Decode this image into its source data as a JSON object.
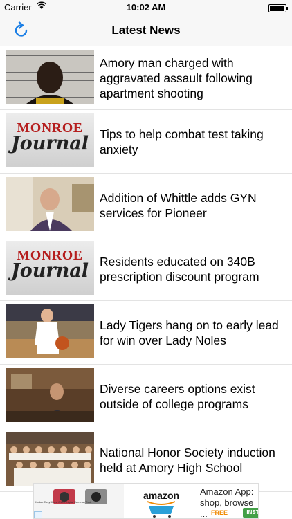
{
  "status_bar": {
    "carrier": "Carrier",
    "time": "10:02 AM"
  },
  "nav": {
    "title": "Latest News"
  },
  "articles": [
    {
      "headline": "Amory man charged with aggravated assault following apartment shooting",
      "thumb": "mugshot"
    },
    {
      "headline": "Tips to help combat test taking anxiety",
      "thumb": "monroe-journal-logo"
    },
    {
      "headline": "Addition of Whittle adds GYN services for Pioneer",
      "thumb": "doctor-portrait"
    },
    {
      "headline": "Residents educated on 340B prescription discount program",
      "thumb": "monroe-journal-logo"
    },
    {
      "headline": "Lady Tigers hang on to early lead for win over Lady Noles",
      "thumb": "basketball-player"
    },
    {
      "headline": "Diverse careers options exist outside of college programs",
      "thumb": "classroom"
    },
    {
      "headline": "National Honor Society induction held at Amory High School",
      "thumb": "group-photo"
    }
  ],
  "journal_logo": {
    "top": "MONROE",
    "bottom": "Journal"
  },
  "ad": {
    "product_text": "Kodak EasyShare C195 Digital Camera (Red)",
    "brand": "amazon",
    "text": "Amazon App: shop, browse ...",
    "price": "FREE",
    "install_label": "INSTALL"
  },
  "colors": {
    "accent": "#1a7ee5",
    "bar_background": "#f7f7f7",
    "journal_red": "#b51e1e",
    "install_green": "#43a047"
  }
}
